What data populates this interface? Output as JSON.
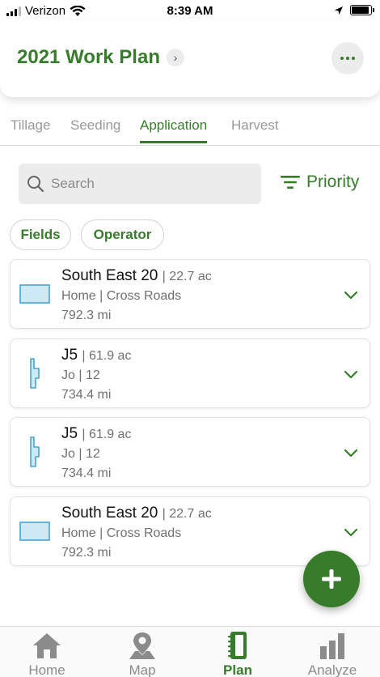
{
  "status_bar": {
    "carrier": "Verizon",
    "time": "8:39 AM",
    "battery_level": 0.9
  },
  "header": {
    "title": "2021 Work Plan",
    "title_chevron": "›",
    "accent_color": "#367c2b"
  },
  "tabs": [
    {
      "label": "Tillage",
      "active": false
    },
    {
      "label": "Seeding",
      "active": false
    },
    {
      "label": "Application",
      "active": true
    },
    {
      "label": "Harvest",
      "active": false
    }
  ],
  "search": {
    "placeholder": "Search",
    "value": ""
  },
  "sort": {
    "label": "Priority"
  },
  "filters": [
    {
      "label": "Fields"
    },
    {
      "label": "Operator"
    }
  ],
  "cards": [
    {
      "name": "South East 20",
      "area": "| 22.7 ac",
      "location": "Home | Cross Roads",
      "distance": "792.3 mi",
      "icon": "field-rectangle-icon"
    },
    {
      "name": "J5",
      "area": "| 61.9 ac",
      "location": "Jo | 12",
      "distance": "734.4 mi",
      "icon": "field-strip-icon"
    },
    {
      "name": "J5",
      "area": "| 61.9 ac",
      "location": "Jo | 12",
      "distance": "734.4 mi",
      "icon": "field-strip-icon"
    },
    {
      "name": "South East 20",
      "area": "| 22.7 ac",
      "location": "Home | Cross Roads",
      "distance": "792.3 mi",
      "icon": "field-rectangle-icon"
    }
  ],
  "fab": {
    "icon": "plus-icon"
  },
  "bottom_nav": [
    {
      "label": "Home",
      "icon": "home-icon",
      "active": false
    },
    {
      "label": "Map",
      "icon": "map-pin-icon",
      "active": false
    },
    {
      "label": "Plan",
      "icon": "notebook-icon",
      "active": true
    },
    {
      "label": "Analyze",
      "icon": "bar-chart-icon",
      "active": false
    }
  ]
}
